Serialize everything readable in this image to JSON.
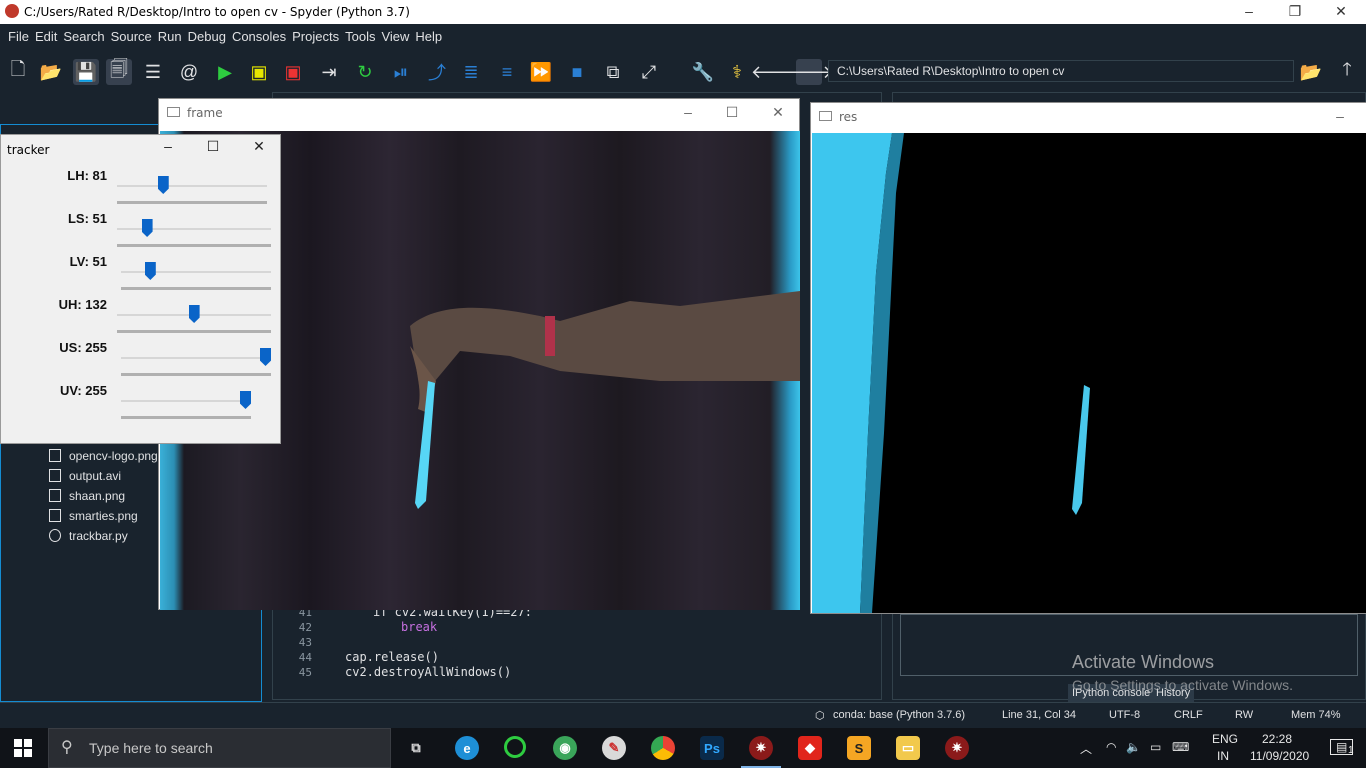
{
  "window": {
    "title": "C:/Users/Rated R/Desktop/Intro to open cv - Spyder (Python 3.7)"
  },
  "menu": [
    "File",
    "Edit",
    "Search",
    "Source",
    "Run",
    "Debug",
    "Consoles",
    "Projects",
    "Tools",
    "View",
    "Help"
  ],
  "toolbar": {
    "path": "C:\\Users\\Rated R\\Desktop\\Intro to open cv"
  },
  "files": [
    "opencv-logo.png",
    "output.avi",
    "shaan.png",
    "smarties.png",
    "trackbar.py"
  ],
  "editor": {
    "lines": [
      {
        "num": "41",
        "code": "if cv2.waitKey(1)==27:"
      },
      {
        "num": "42",
        "code": "break"
      },
      {
        "num": "43",
        "code": ""
      },
      {
        "num": "44",
        "code": "cap.release()"
      },
      {
        "num": "45",
        "code": "cv2.destroyAllWindows()"
      }
    ]
  },
  "frame_window": {
    "title": "frame"
  },
  "res_window": {
    "title": "res"
  },
  "tracker": {
    "title": "tracker",
    "sliders": [
      {
        "label": "LH: 81",
        "value": 81,
        "max": 255
      },
      {
        "label": "LS: 51",
        "value": 51,
        "max": 255
      },
      {
        "label": "LV: 51",
        "value": 51,
        "max": 255
      },
      {
        "label": "UH: 132",
        "value": 132,
        "max": 255
      },
      {
        "label": "US: 255",
        "value": 255,
        "max": 255
      },
      {
        "label": "UV: 255",
        "value": 255,
        "max": 255
      }
    ]
  },
  "console_tabs": [
    "IPython console",
    "History"
  ],
  "watermark": {
    "line1": "Activate Windows",
    "line2": "Go to Settings to activate Windows."
  },
  "statusbar": {
    "conda": "conda: base (Python 3.7.6)",
    "position": "Line 31, Col 34",
    "encoding": "UTF-8",
    "eol": "CRLF",
    "perm": "RW",
    "mem": "Mem 74%"
  },
  "taskbar": {
    "search_placeholder": "Type here to search",
    "lang1": "ENG",
    "lang2": "IN",
    "time": "22:28",
    "date": "11/09/2020",
    "notifications": "1"
  },
  "colors": {
    "accent": "#148cd2",
    "slider_thumb": "#0a64c8",
    "taskbar": "#101318"
  }
}
